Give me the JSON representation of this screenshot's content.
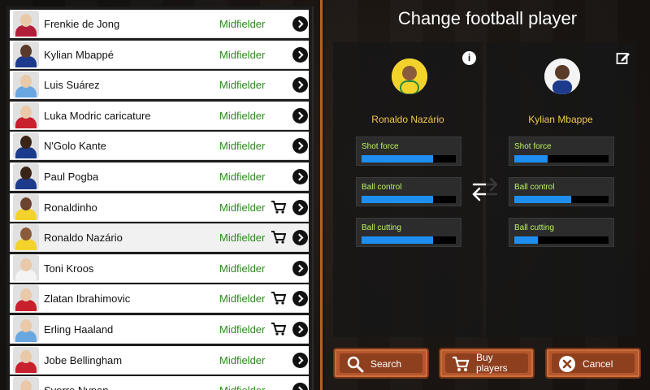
{
  "players_list": [
    {
      "name": "Frenkie de Jong",
      "position": "Midfielder",
      "cart": false,
      "selected": false
    },
    {
      "name": "Kylian Mbappé",
      "position": "Midfielder",
      "cart": false,
      "selected": false
    },
    {
      "name": "Luis Suárez",
      "position": "Midfielder",
      "cart": false,
      "selected": false
    },
    {
      "name": "Luka Modric caricature",
      "position": "Midfielder",
      "cart": false,
      "selected": false
    },
    {
      "name": "N'Golo Kante",
      "position": "Midfielder",
      "cart": false,
      "selected": false
    },
    {
      "name": "Paul Pogba",
      "position": "Midfielder",
      "cart": false,
      "selected": false
    },
    {
      "name": "Ronaldinho",
      "position": "Midfielder",
      "cart": true,
      "selected": false
    },
    {
      "name": "Ronaldo Nazário",
      "position": "Midfielder",
      "cart": true,
      "selected": true
    },
    {
      "name": "Toni Kroos",
      "position": "Midfielder",
      "cart": false,
      "selected": false
    },
    {
      "name": "Zlatan Ibrahimovic",
      "position": "Midfielder",
      "cart": true,
      "selected": false
    },
    {
      "name": "Erling Haaland",
      "position": "Midfielder",
      "cart": true,
      "selected": false
    },
    {
      "name": "Jobe Bellingham",
      "position": "Midfielder",
      "cart": false,
      "selected": false
    },
    {
      "name": "Sverre Nypan",
      "position": "Midfielder",
      "cart": false,
      "selected": false
    }
  ],
  "header": {
    "title": "Change football player"
  },
  "compare": {
    "left": {
      "name": "Ronaldo Nazário",
      "stats": [
        {
          "label": "Shot force",
          "value": 0.76
        },
        {
          "label": "Ball control",
          "value": 0.76
        },
        {
          "label": "Ball cutting",
          "value": 0.76
        }
      ]
    },
    "right": {
      "name": "Kylian Mbappe",
      "stats": [
        {
          "label": "Shot force",
          "value": 0.35
        },
        {
          "label": "Ball control",
          "value": 0.6
        },
        {
          "label": "Ball cutting",
          "value": 0.25
        }
      ]
    }
  },
  "buttons": {
    "search": "Search",
    "buy_line1": "Buy",
    "buy_line2": "players",
    "cancel": "Cancel"
  },
  "colors": {
    "accent": "#c76a1e",
    "position_text": "#2a8a1a",
    "stat_label": "#b9f25f",
    "stat_fill": "#1e8ef0",
    "name_gold": "#f2c94c"
  },
  "icons": [
    "chevron-right-icon",
    "cart-icon",
    "info-icon",
    "edit-icon",
    "swap-arrows-icon",
    "search-icon",
    "cart-icon",
    "cancel-x-icon"
  ]
}
